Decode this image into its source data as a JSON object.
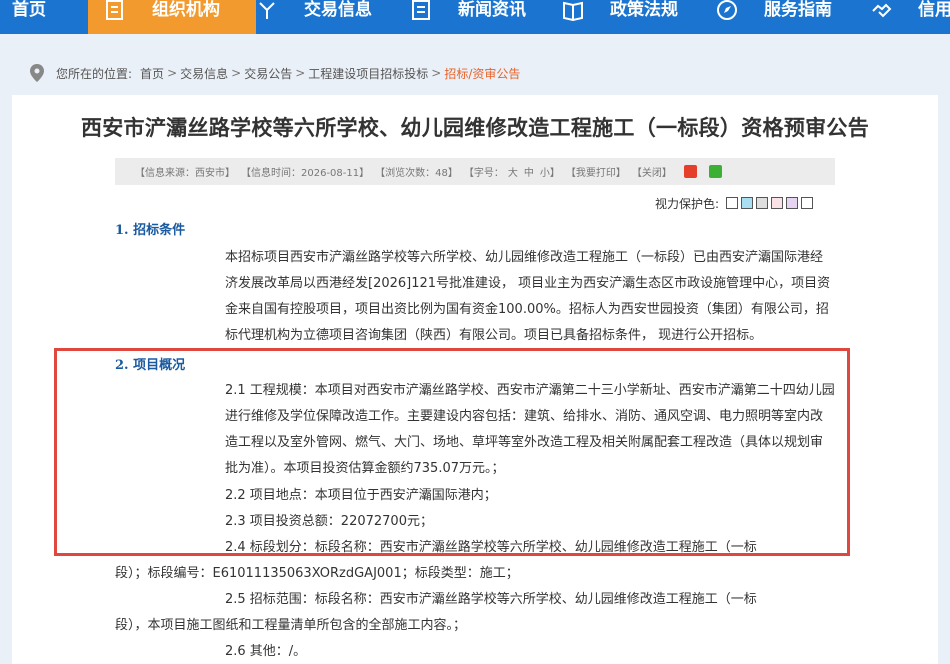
{
  "nav": {
    "items": [
      {
        "label": "首页",
        "icon": "home-icon",
        "active": false
      },
      {
        "label": "组织机构",
        "icon": "document-icon",
        "active": true
      },
      {
        "label": "交易信息",
        "icon": "flag-icon",
        "active": false
      },
      {
        "label": "新闻资讯",
        "icon": "list-icon",
        "active": false
      },
      {
        "label": "政策法规",
        "icon": "book-icon",
        "active": false
      },
      {
        "label": "服务指南",
        "icon": "compass-icon",
        "active": false
      },
      {
        "label": "信用",
        "icon": "handshake-icon",
        "active": false
      }
    ]
  },
  "breadcrumb": {
    "prefix": "您所在的位置:",
    "items": [
      "首页",
      "交易信息",
      "交易公告",
      "工程建设项目招标投标"
    ],
    "current": "招标/资审公告"
  },
  "article": {
    "title": "西安市浐灞丝路学校等六所学校、幼儿园维修改造工程施工（一标段）资格预审公告",
    "info": {
      "source": "【信息来源：西安市】",
      "time": "【信息时间：2026-08-11】",
      "views": "【浏览次数：48】",
      "font_label": "【字号：",
      "font_large": "大",
      "font_medium": "中",
      "font_small": "小】",
      "print": "【我要打印】",
      "close": "【关闭】"
    },
    "eye_protect_label": "视力保护色:",
    "eye_colors": [
      "#ffffff",
      "#a9dff0",
      "#dedede",
      "#fbe2e6",
      "#e6d4f2",
      "#ffffff"
    ],
    "section1_title": "1. 招标条件",
    "section1_text": "本招标项目西安市浐灞丝路学校等六所学校、幼儿园维修改造工程施工（一标段）已由西安浐灞国际港经济发展改革局以西港经发[2026]121号批准建设， 项目业主为西安浐灞生态区市政设施管理中心，项目资金来自国有控股项目，项目出资比例为国有资金100.00%。招标人为西安世园投资（集团）有限公司，招标代理机构为立德项目咨询集团（陕西）有限公司。项目已具备招标条件， 现进行公开招标。",
    "section2_title": "2. 项目概况",
    "item21": "2.1 工程规模：本项目对西安市浐灞丝路学校、西安市浐灞第二十三小学新址、西安市浐灞第二十四幼儿园进行维修及学位保障改造工作。主要建设内容包括：建筑、给排水、消防、通风空调、电力照明等室内改造工程以及室外管网、燃气、大门、场地、草坪等室外改造工程及相关附属配套工程改造（具体以规划审批为准）。本项目投资估算金额约735.07万元。；",
    "item22": "2.2 项目地点：本项目位于西安浐灞国际港内；",
    "item23": "2.3 项目投资总额：22072700元；",
    "item24_line1": "2.4 标段划分：标段名称：西安市浐灞丝路学校等六所学校、幼儿园维修改造工程施工（一标",
    "item24_line2": "段）；标段编号：E61011135063XORzdGAJ001；标段类型：施工；",
    "item25_line1": "2.5 招标范围：标段名称：西安市浐灞丝路学校等六所学校、幼儿园维修改造工程施工（一标",
    "item25_line2": "段），本项目施工图纸和工程量清单所包含的全部施工内容。；",
    "item26": "2.6 其他：/。"
  },
  "colors": {
    "nav_bg": "#1b75d0",
    "nav_active": "#f29a2e",
    "section_title": "#1a5aa0",
    "highlight_border": "#e0473e",
    "breadcrumb_current": "#e8632a"
  }
}
